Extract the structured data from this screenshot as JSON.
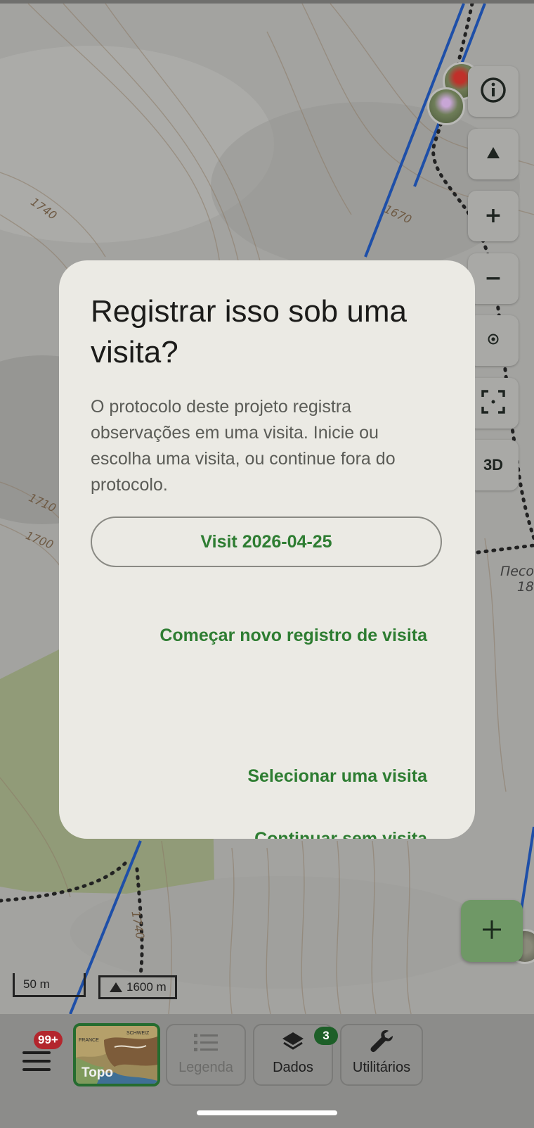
{
  "map": {
    "contour_labels": [
      "1740",
      "1670",
      "1710",
      "1700",
      "1740"
    ],
    "place_label_lines": [
      "Песо",
      "18"
    ]
  },
  "map_controls": {
    "info_icon": "info-icon",
    "north_arrow_icon": "north-arrow-icon",
    "zoom_in": "+",
    "zoom_out": "−",
    "locate_icon": "location-icon",
    "fullscreen_icon": "fullscreen-icon",
    "three_d_label": "3D",
    "add_icon": "plus-icon"
  },
  "scale": {
    "distance": "50 m",
    "altitude": "1600 m"
  },
  "bottom_nav": {
    "menu_badge": "99+",
    "topo_label": "Topo",
    "topo_thumb_labels": [
      "FRANCE",
      "SCHWEIZ"
    ],
    "legend_label": "Legenda",
    "data_label": "Dados",
    "data_badge": "3",
    "tools_label": "Utilitários"
  },
  "dialog": {
    "title": "Registrar isso sob uma visita?",
    "body": "O protocolo deste projeto registra observações em uma visita. Inicie ou escolha uma visita, ou continue fora do protocolo.",
    "visit_button": "Visit 2026-04-25",
    "new_visit": "Começar novo registro de visita",
    "select_visit": "Selecionar uma visita",
    "continue_without": "Continuar sem visita"
  },
  "colors": {
    "accent_green": "#2e7d32",
    "badge_red": "#b3262d",
    "dialog_bg": "#ebeae4"
  }
}
